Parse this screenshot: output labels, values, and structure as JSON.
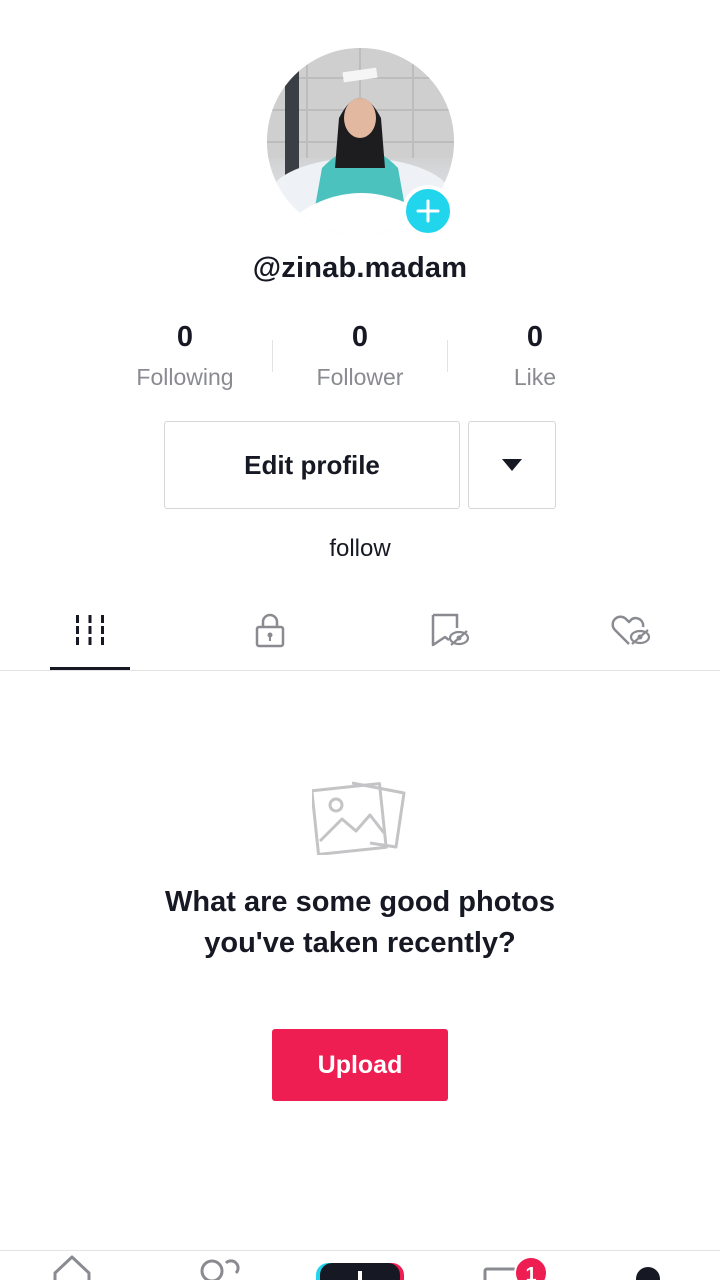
{
  "profile": {
    "username": "@zinab.madam",
    "avatar_icon": "profile-photo",
    "add_icon": "plus-icon"
  },
  "stats": [
    {
      "value": "0",
      "label": "Following"
    },
    {
      "value": "0",
      "label": "Follower"
    },
    {
      "value": "0",
      "label": "Like"
    }
  ],
  "actions": {
    "edit_profile_label": "Edit profile",
    "more_icon": "caret-down-icon",
    "follow_label": "follow"
  },
  "tabs": [
    {
      "icon": "grid-icon",
      "active": true
    },
    {
      "icon": "lock-icon",
      "active": false
    },
    {
      "icon": "bookmark-hidden-icon",
      "active": false
    },
    {
      "icon": "heart-hidden-icon",
      "active": false
    }
  ],
  "empty_state": {
    "icon": "photos-icon",
    "message": "What are some good photos you've taken recently?",
    "upload_label": "Upload"
  },
  "bottom_nav": {
    "items": [
      "home-icon",
      "friends-icon",
      "create-icon",
      "inbox-icon",
      "profile-icon"
    ],
    "inbox_badge": "1"
  },
  "colors": {
    "accent": "#ee1d52",
    "teal": "#20d5ec",
    "text": "#161823",
    "muted": "#8a8b91"
  }
}
